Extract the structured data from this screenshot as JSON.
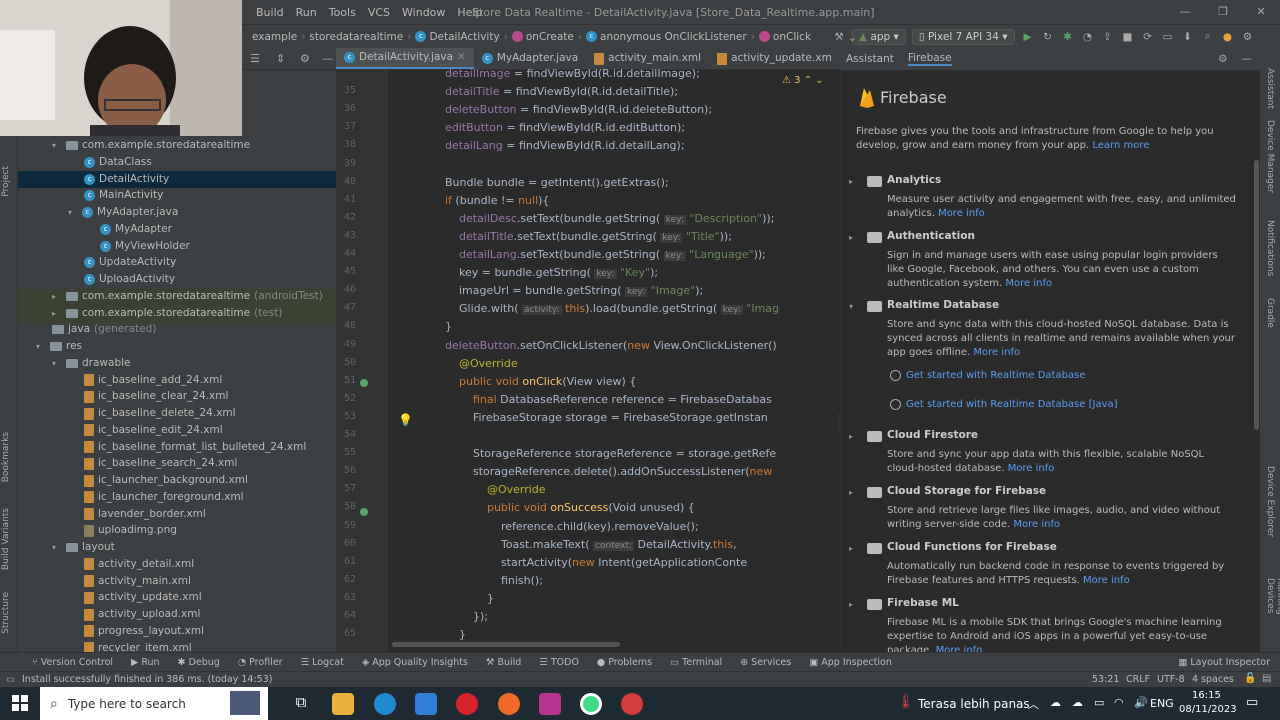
{
  "menu": {
    "items": [
      "Build",
      "Run",
      "Tools",
      "VCS",
      "Window",
      "Help"
    ],
    "window_title": "Store Data Realtime - DetailActivity.java [Store_Data_Realtime.app.main]"
  },
  "nav": {
    "crumbs": [
      "example",
      "storedatarealtime",
      "DetailActivity",
      "onCreate",
      "anonymous OnClickListener",
      "onClick"
    ],
    "run_config": "app",
    "device": "Pixel 7 API 34"
  },
  "project": {
    "rows": [
      {
        "label": "com.example.storedatarealtime",
        "kind": "folder",
        "arrow": "▾"
      },
      {
        "label": "DataClass",
        "kind": "class"
      },
      {
        "label": "DetailActivity",
        "kind": "class"
      },
      {
        "label": "MainActivity",
        "kind": "class"
      },
      {
        "label": "MyAdapter.java",
        "kind": "class",
        "arrow": "▾"
      },
      {
        "label": "MyAdapter",
        "kind": "class"
      },
      {
        "label": "MyViewHolder",
        "kind": "class"
      },
      {
        "label": "UpdateActivity",
        "kind": "class"
      },
      {
        "label": "UploadActivity",
        "kind": "class"
      },
      {
        "label": "com.example.storedatarealtime",
        "kind": "folder",
        "arrow": "▸",
        "suffix": "(androidTest)"
      },
      {
        "label": "com.example.storedatarealtime",
        "kind": "folder",
        "arrow": "▸",
        "suffix": "(test)"
      },
      {
        "label": "java",
        "kind": "folder",
        "suffix": "(generated)"
      },
      {
        "label": "res",
        "kind": "folder",
        "arrow": "▾"
      },
      {
        "label": "drawable",
        "kind": "folder",
        "arrow": "▾"
      },
      {
        "label": "ic_baseline_add_24.xml",
        "kind": "xml"
      },
      {
        "label": "ic_baseline_clear_24.xml",
        "kind": "xml"
      },
      {
        "label": "ic_baseline_delete_24.xml",
        "kind": "xml"
      },
      {
        "label": "ic_baseline_edit_24.xml",
        "kind": "xml"
      },
      {
        "label": "ic_baseline_format_list_bulleted_24.xml",
        "kind": "xml"
      },
      {
        "label": "ic_baseline_search_24.xml",
        "kind": "xml"
      },
      {
        "label": "ic_launcher_background.xml",
        "kind": "xml"
      },
      {
        "label": "ic_launcher_foreground.xml",
        "kind": "xml"
      },
      {
        "label": "lavender_border.xml",
        "kind": "xml"
      },
      {
        "label": "uploadimg.png",
        "kind": "png"
      },
      {
        "label": "layout",
        "kind": "folder",
        "arrow": "▾"
      },
      {
        "label": "activity_detail.xml",
        "kind": "xml"
      },
      {
        "label": "activity_main.xml",
        "kind": "xml"
      },
      {
        "label": "activity_update.xml",
        "kind": "xml"
      },
      {
        "label": "activity_upload.xml",
        "kind": "xml"
      },
      {
        "label": "progress_layout.xml",
        "kind": "xml"
      },
      {
        "label": "recycler_item.xml",
        "kind": "xml"
      }
    ],
    "side_labels": [
      "Project",
      "Bookmarks",
      "Build Variants",
      "Structure"
    ]
  },
  "editor": {
    "tabs": [
      {
        "label": "DetailActivity.java",
        "kind": "class",
        "active": true
      },
      {
        "label": "MyAdapter.java",
        "kind": "class"
      },
      {
        "label": "activity_main.xml",
        "kind": "xml"
      },
      {
        "label": "activity_update.xm",
        "kind": "xml"
      }
    ],
    "warnings": "3",
    "lines": [
      {
        "n": "",
        "t": "detailImage = findViewById(R.id.detailImage);"
      },
      {
        "n": "35",
        "t": "detailTitle = findViewById(R.id.detailTitle);"
      },
      {
        "n": "36",
        "t": "deleteButton = findViewById(R.id.deleteButton);"
      },
      {
        "n": "37",
        "t": "editButton = findViewById(R.id.editButton);"
      },
      {
        "n": "38",
        "t": "detailLang = findViewById(R.id.detailLang);"
      },
      {
        "n": "39",
        "t": ""
      },
      {
        "n": "40",
        "t": "Bundle bundle = getIntent().getExtras();"
      },
      {
        "n": "41",
        "t": "if (bundle != null){"
      },
      {
        "n": "42",
        "t": "    detailDesc.setText(bundle.getString( key: \"Description\"));"
      },
      {
        "n": "43",
        "t": "    detailTitle.setText(bundle.getString( key: \"Title\"));"
      },
      {
        "n": "44",
        "t": "    detailLang.setText(bundle.getString( key: \"Language\"));"
      },
      {
        "n": "45",
        "t": "    key = bundle.getString( key: \"Key\");"
      },
      {
        "n": "46",
        "t": "    imageUrl = bundle.getString( key: \"Image\");"
      },
      {
        "n": "47",
        "t": "    Glide.with( activity: this).load(bundle.getString( key: \"Imag"
      },
      {
        "n": "48",
        "t": "}"
      },
      {
        "n": "49",
        "t": "deleteButton.setOnClickListener(new View.OnClickListener()"
      },
      {
        "n": "50",
        "t": "    @Override"
      },
      {
        "n": "51",
        "t": "    public void onClick(View view) {"
      },
      {
        "n": "52",
        "t": "        final DatabaseReference reference = FirebaseDatabas"
      },
      {
        "n": "53",
        "t": "        FirebaseStorage storage = FirebaseStorage.getInstan"
      },
      {
        "n": "54",
        "t": ""
      },
      {
        "n": "55",
        "t": "        StorageReference storageReference = storage.getRefe"
      },
      {
        "n": "56",
        "t": "        storageReference.delete().addOnSuccessListener(new"
      },
      {
        "n": "57",
        "t": "            @Override"
      },
      {
        "n": "58",
        "t": "            public void onSuccess(Void unused) {"
      },
      {
        "n": "59",
        "t": "                reference.child(key).removeValue();"
      },
      {
        "n": "60",
        "t": "                Toast.makeText( context: DetailActivity.this,"
      },
      {
        "n": "61",
        "t": "                startActivity(new Intent(getApplicationConte"
      },
      {
        "n": "62",
        "t": "                finish();"
      },
      {
        "n": "63",
        "t": "            }"
      },
      {
        "n": "64",
        "t": "        });"
      },
      {
        "n": "65",
        "t": "    }"
      }
    ]
  },
  "assistant": {
    "tabs": [
      "Assistant",
      "Firebase"
    ],
    "title": "Firebase",
    "intro": "Firebase gives you the tools and infrastructure from Google to help you develop, grow and earn money from your app.",
    "learn_more": "Learn more",
    "more_info": "More info",
    "sections": [
      {
        "name": "Analytics",
        "desc": "Measure user activity and engagement with free, easy, and unlimited analytics.",
        "expanded": false
      },
      {
        "name": "Authentication",
        "desc": "Sign in and manage users with ease using popular login providers like Google, Facebook, and others. You can even use a custom authentication system.",
        "expanded": false
      },
      {
        "name": "Realtime Database",
        "desc": "Store and sync data with this cloud-hosted NoSQL database. Data is synced across all clients in realtime and remains available when your app goes offline.",
        "expanded": true
      },
      {
        "name": "Cloud Firestore",
        "desc": "Store and sync your app data with this flexible, scalable NoSQL cloud-hosted database.",
        "expanded": false
      },
      {
        "name": "Cloud Storage for Firebase",
        "desc": "Store and retrieve large files like images, audio, and video without writing server-side code.",
        "expanded": false
      },
      {
        "name": "Cloud Functions for Firebase",
        "desc": "Automatically run backend code in response to events triggered by Firebase features and HTTPS requests.",
        "expanded": false
      },
      {
        "name": "Firebase ML",
        "desc": "Firebase ML is a mobile SDK that brings Google's machine learning expertise to Android and iOS apps in a powerful yet easy-to-use package.",
        "expanded": false
      }
    ],
    "get_started": [
      "Get started with Realtime Database",
      "Get started with Realtime Database [Java]"
    ]
  },
  "right_strip": [
    "Assistant",
    "Device Manager",
    "Notifications",
    "Gradle",
    "Device Explorer",
    "Running Devices"
  ],
  "bottom_tools": [
    "Version Control",
    "Run",
    "Debug",
    "Profiler",
    "Logcat",
    "App Quality Insights",
    "Build",
    "TODO",
    "Problems",
    "Terminal",
    "Services",
    "App Inspection",
    "Layout Inspector"
  ],
  "status": {
    "message": "Install successfully finished in 386 ms. (today 14:53)",
    "position": "53:21",
    "line_sep": "CRLF",
    "encoding": "UTF-8",
    "indent": "4 spaces"
  },
  "taskbar": {
    "search_placeholder": "Type here to search",
    "weather": "Terasa lebih panas",
    "lang": "ENG",
    "time": "16:15",
    "date": "08/11/2023"
  }
}
